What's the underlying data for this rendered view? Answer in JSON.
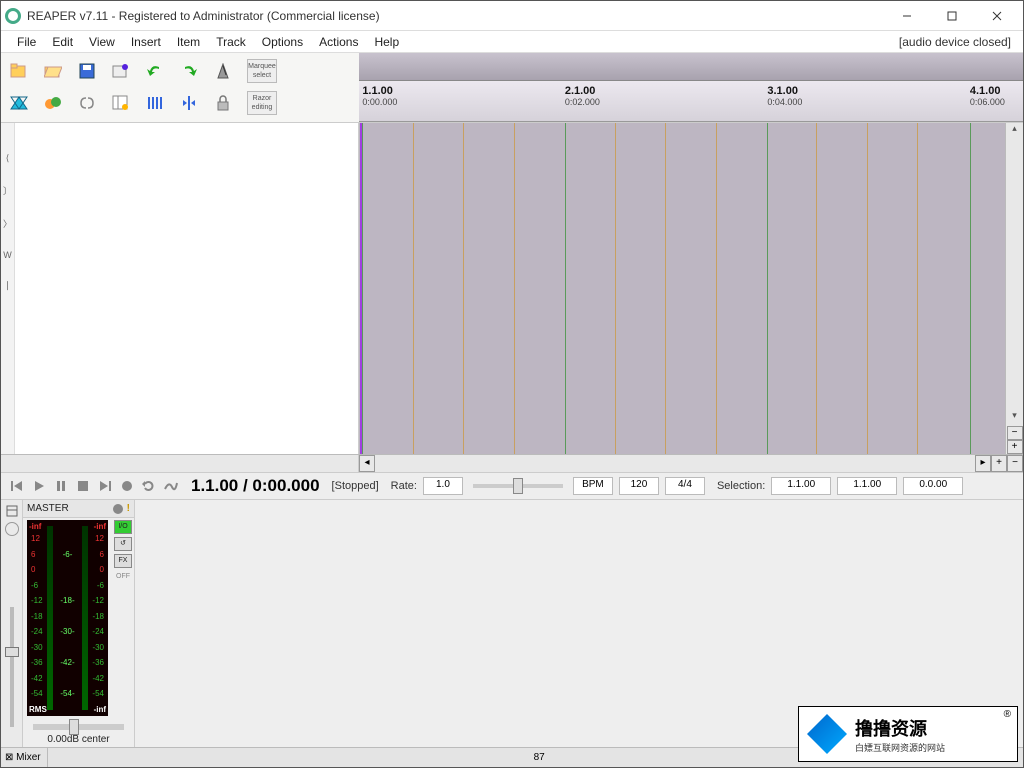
{
  "title": "REAPER v7.11 - Registered to Administrator (Commercial license)",
  "device_note": "[audio device closed]",
  "menu": [
    "File",
    "Edit",
    "View",
    "Insert",
    "Item",
    "Track",
    "Options",
    "Actions",
    "Help"
  ],
  "toolbar_buttons": {
    "marquee": "Marquee select",
    "razor": "Razor editing"
  },
  "ruler_marks": [
    {
      "bar": "1.1.00",
      "time": "0:00.000",
      "pct": 0.5
    },
    {
      "bar": "2.1.00",
      "time": "0:02.000",
      "pct": 31
    },
    {
      "bar": "3.1.00",
      "time": "0:04.000",
      "pct": 61.5
    },
    {
      "bar": "4.1.00",
      "time": "0:06.000",
      "pct": 92
    }
  ],
  "transport": {
    "position": "1.1.00 / 0:00.000",
    "status": "[Stopped]",
    "rate_label": "Rate:",
    "rate": "1.0",
    "bpm_label": "BPM",
    "bpm": "120",
    "sig": "4/4",
    "sel_label": "Selection:",
    "sel_start": "1.1.00",
    "sel_end": "1.1.00",
    "sel_len": "0.0.00"
  },
  "master": {
    "label": "MASTER",
    "top_l": "-inf",
    "top_r": "-inf",
    "bot_l": "RMS",
    "bot_r": "-inf",
    "ticks_left": [
      "12",
      "6",
      "0",
      "-6",
      "-12",
      "-18",
      "-24",
      "-30",
      "-36",
      "-42",
      "-54"
    ],
    "ticks_mid": [
      "",
      "-6-",
      "",
      "",
      "-18-",
      "",
      "-30-",
      "",
      "-42-",
      "",
      "-54-"
    ],
    "ticks_right": [
      "12",
      "6",
      "0",
      "-6",
      "-12",
      "-18",
      "-24",
      "-30",
      "-36",
      "-42",
      "-54"
    ],
    "fader": "0.00dB center"
  },
  "side_btns": [
    "I/O",
    "↺",
    "FX",
    "OFF"
  ],
  "statusbar": {
    "mixer": "⊠ Mixer",
    "num": "87"
  },
  "watermark": {
    "big": "撸撸资源",
    "small": "白嫖互联网资源的网站"
  }
}
